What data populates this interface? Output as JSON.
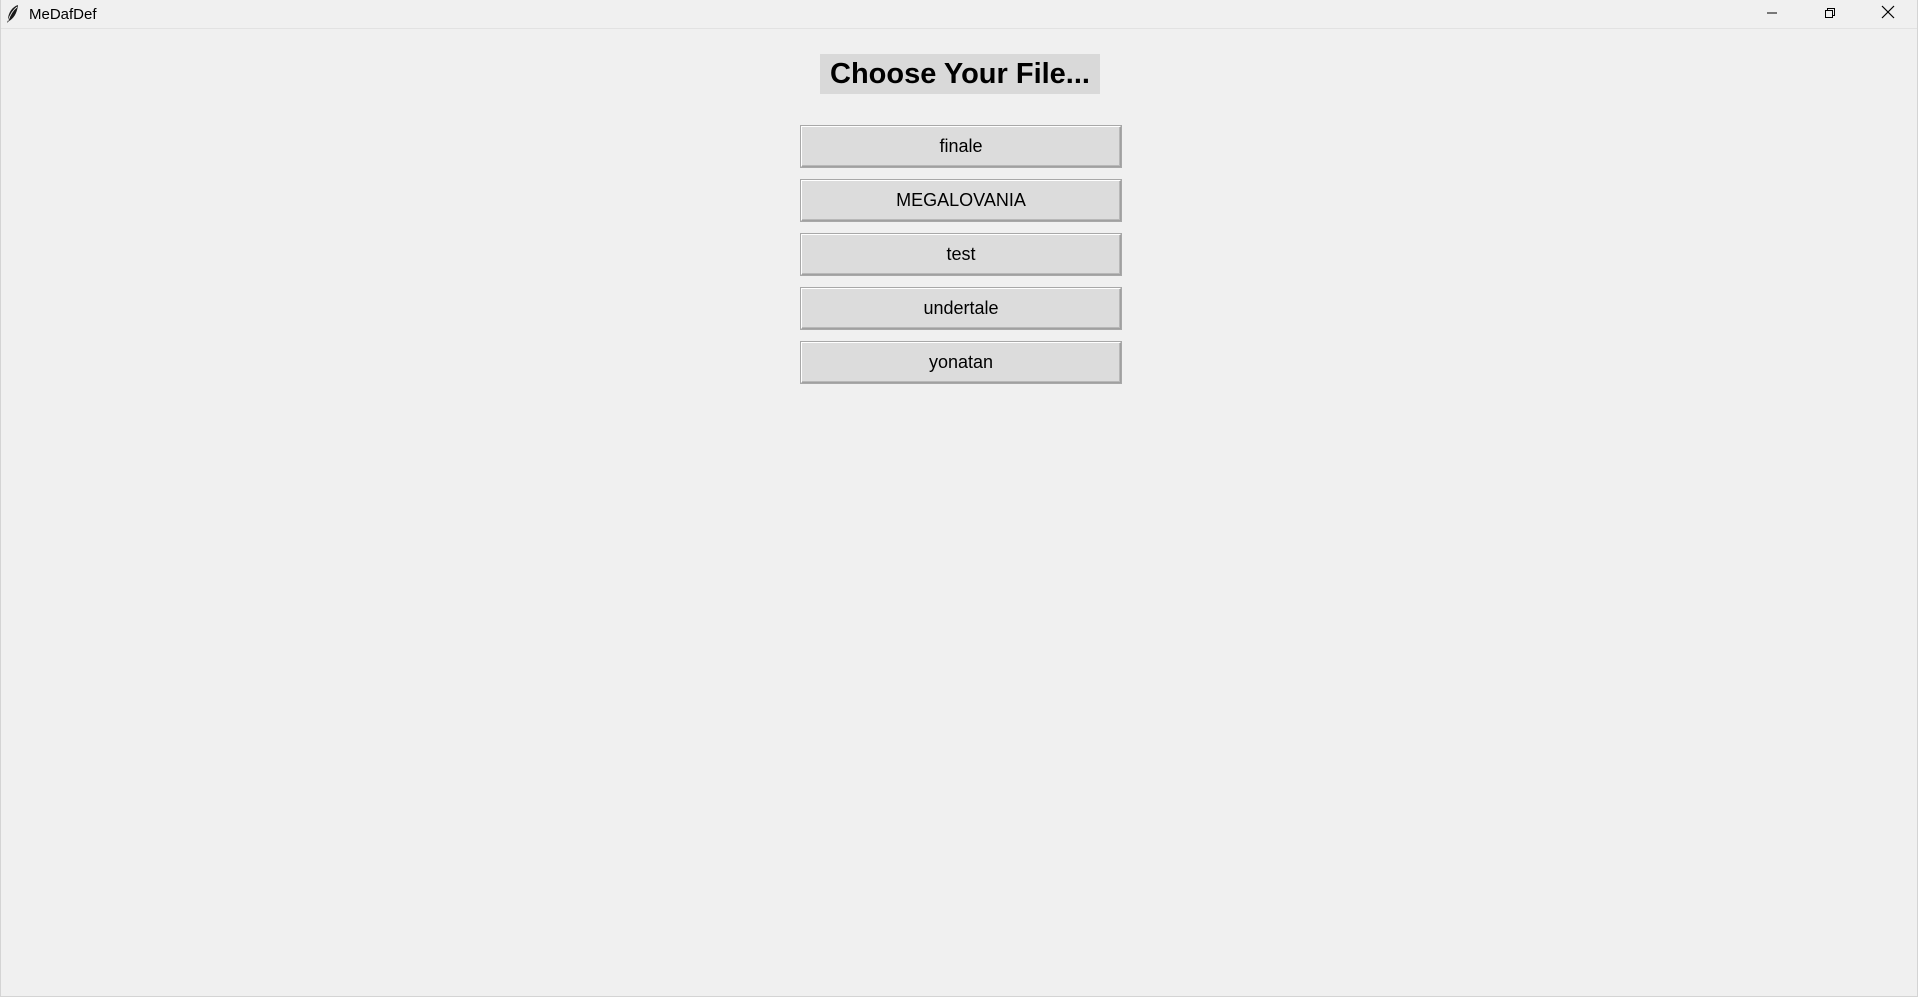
{
  "window": {
    "title": "MeDafDef",
    "icon": "feather-icon",
    "controls": {
      "minimize_icon": "minimize-icon",
      "maximize_icon": "restore-icon",
      "close_icon": "close-icon"
    }
  },
  "main": {
    "heading": "Choose Your File...",
    "files": [
      {
        "label": "finale"
      },
      {
        "label": "MEGALOVANIA"
      },
      {
        "label": "test"
      },
      {
        "label": "undertale"
      },
      {
        "label": "yonatan"
      }
    ]
  },
  "colors": {
    "background": "#f0f0f0",
    "button_face": "#dcdcdc",
    "heading_bg": "#d9d9d9"
  }
}
